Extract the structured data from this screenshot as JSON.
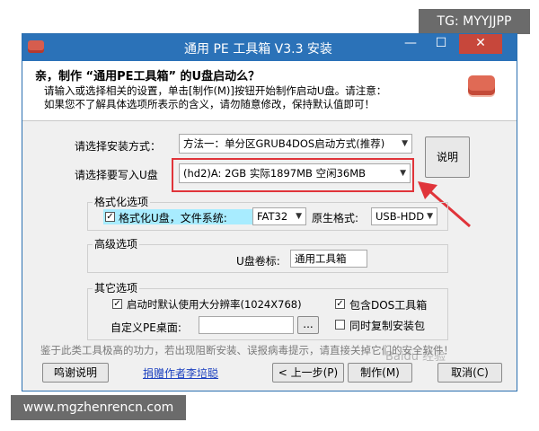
{
  "watermark": {
    "top_right": "TG: MYYJJPP",
    "bottom_left": "www.mgzhenrencn.com",
    "baidu": "Baidu 经验"
  },
  "window": {
    "title": "通用 PE 工具箱 V3.3 安装",
    "minimize_glyph": "—",
    "maximize_glyph": "☐",
    "close_glyph": "✕"
  },
  "header": {
    "title": "亲，制作 “通用PE工具箱” 的U盘启动么？",
    "desc_line1": "请输入或选择相关的设置，单击[制作(M)]按钮开始制作启动U盘。请注意：",
    "desc_line2": "如果您不了解具体选项所表示的含义，请勿随意修改，保持默认值即可！"
  },
  "form": {
    "method_label": "请选择安装方式：",
    "method_value": "方法一：单分区GRUB4DOS启动方式(推荐)",
    "usb_label": "请选择要写入U盘",
    "usb_value": "(hd2)A: 2GB 实际1897MB 空闲36MB",
    "explain_button": "说明"
  },
  "format_group": {
    "legend": "格式化选项",
    "format_checkbox_label": "格式化U盘，文件系统:",
    "format_checked": true,
    "fs_value": "FAT32",
    "native_format_label": "原生格式:",
    "native_format_value": "USB-HDD"
  },
  "advanced_group": {
    "legend": "高级选项",
    "volume_label": "U盘卷标:",
    "volume_value": "通用工具箱"
  },
  "other_group": {
    "legend": "其它选项",
    "high_res_label": "启动时默认使用大分辨率(1024X768)",
    "high_res_checked": true,
    "dos_tools_label": "包含DOS工具箱",
    "dos_tools_checked": true,
    "custom_desktop_label": "自定义PE桌面:",
    "custom_desktop_value": "",
    "browse_button": "...",
    "copy_installer_label": "同时复制安装包",
    "copy_installer_checked": false
  },
  "footer": {
    "notice": "鉴于此类工具极高的功力，若出现阻断安装、误报病毒提示，请直接关掉它们的安全软件！",
    "thanks_button": "鸣谢说明",
    "donate_link": "捐赠作者李培聪",
    "back_button": "< 上一步(P)",
    "make_button": "制作(M)",
    "cancel_button": "取消(C)"
  },
  "colors": {
    "title_bar": "#2b72b8",
    "highlight": "#e0343a",
    "arrow": "#e0343a",
    "selected_checkbox_bg": "#a8ecff"
  }
}
